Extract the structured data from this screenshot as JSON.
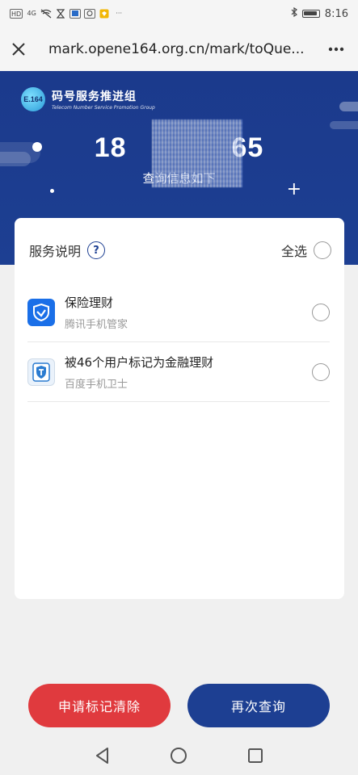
{
  "status_bar": {
    "left_icons": [
      "HD",
      "4G",
      "wifi-off-icon",
      "hourglass-icon",
      "news-icon",
      "camera-icon",
      "shield-icon"
    ],
    "left_labels": [
      "HD",
      "4G"
    ],
    "overflow": "···",
    "time": "8:16",
    "battery_level": 0.8
  },
  "browser": {
    "url": "mark.opene164.org.cn/mark/toQue..."
  },
  "hero": {
    "logo_badge": "E.164",
    "logo_title": "码号服务推进组",
    "logo_subtitle": "Telecom Number Service Promotion Group",
    "phone_prefix": "18",
    "phone_suffix": "65",
    "subtitle": "查询信息如下",
    "plus": "+"
  },
  "card": {
    "title": "服务说明",
    "help_icon": "?",
    "select_all_label": "全选",
    "items": [
      {
        "title": "保险理财",
        "source": "腾讯手机管家",
        "icon": "tencent-shield-icon"
      },
      {
        "title": "被46个用户标记为金融理财",
        "source": "百度手机卫士",
        "icon": "baidu-shield-icon"
      }
    ]
  },
  "actions": {
    "clear_label": "申请标记清除",
    "requery_label": "再次查询"
  },
  "colors": {
    "primary": "#1d3f92",
    "danger": "#e03a3e"
  }
}
